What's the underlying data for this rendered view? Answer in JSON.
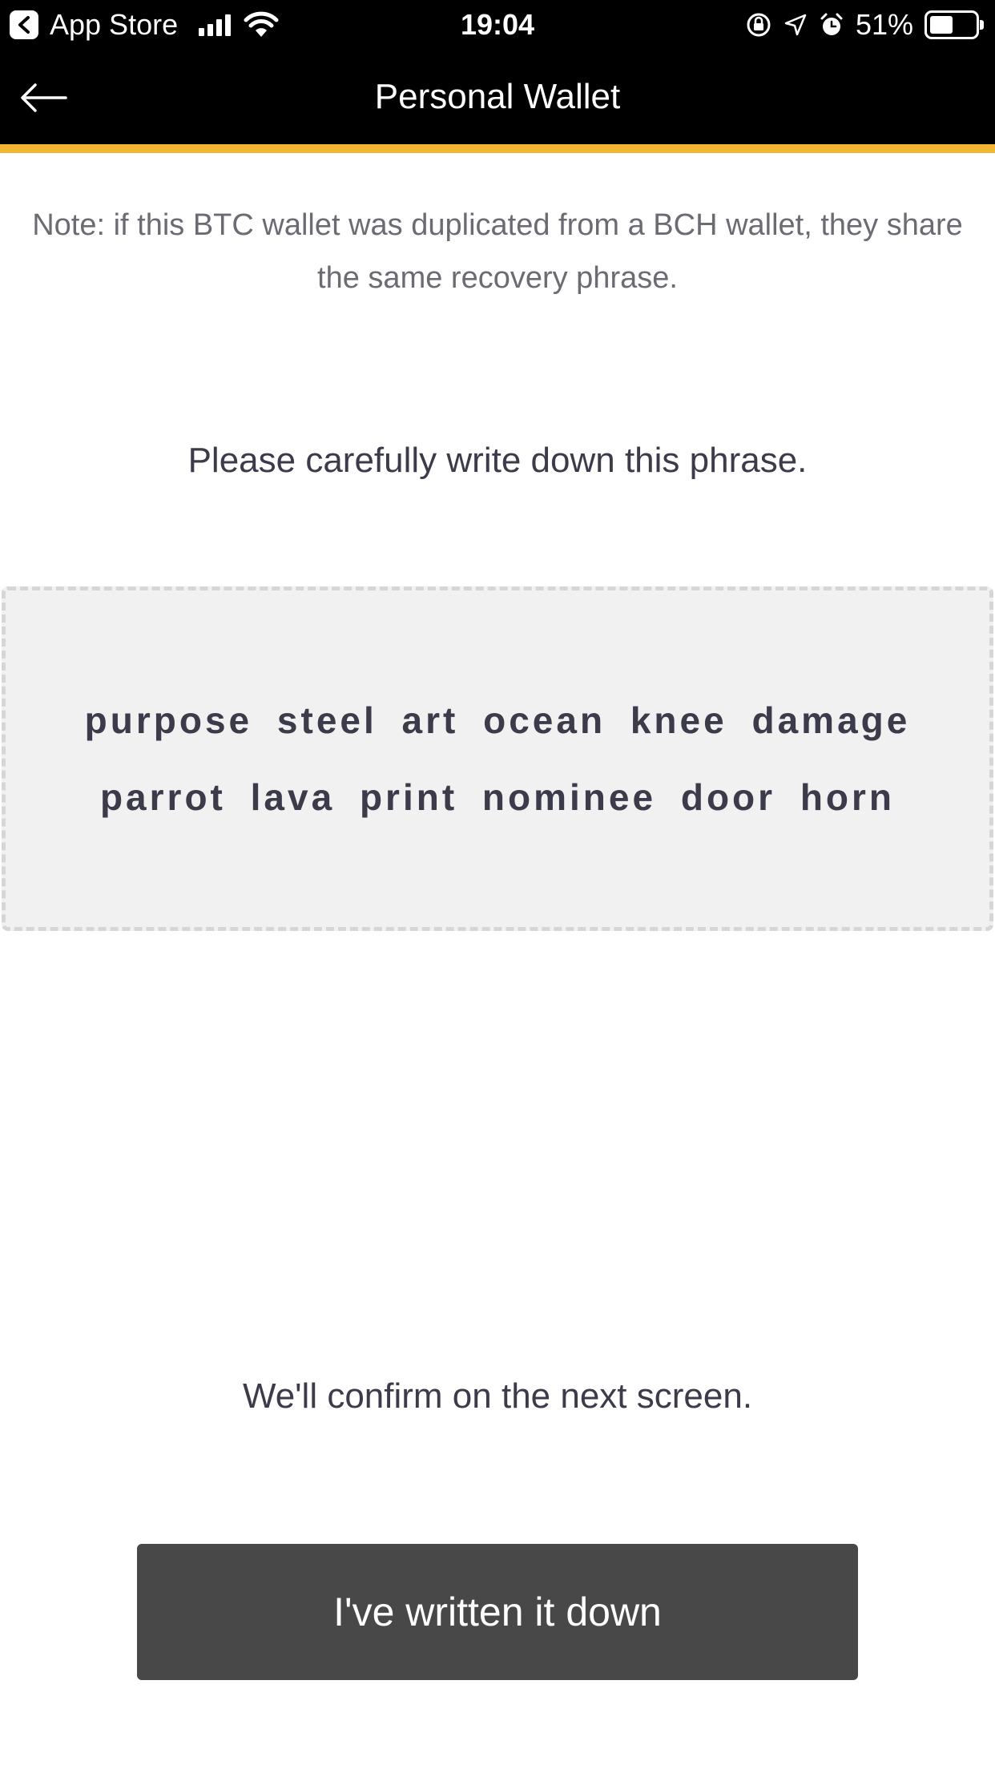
{
  "status_bar": {
    "back_app_label": "App Store",
    "time": "19:04",
    "battery_percent_label": "51%",
    "battery_level": 0.51,
    "icons": [
      "back-app-icon",
      "signal-icon",
      "wifi-icon",
      "orientation-lock-icon",
      "location-icon",
      "alarm-icon",
      "battery-icon"
    ]
  },
  "nav": {
    "title": "Personal Wallet",
    "back_icon": "arrow-left-icon",
    "accent_color": "#f2b632",
    "background_color": "#000000"
  },
  "content": {
    "note": "Note: if this BTC wallet was duplicated from a BCH wallet, they share the same recovery phrase.",
    "instruction": "Please carefully write down this phrase.",
    "recovery_phrase": "purpose steel art ocean knee damage parrot lava print nominee door horn",
    "confirm_note": "We'll confirm on the next screen."
  },
  "actions": {
    "primary_label": "I've written it down",
    "primary_color": "#484848"
  }
}
